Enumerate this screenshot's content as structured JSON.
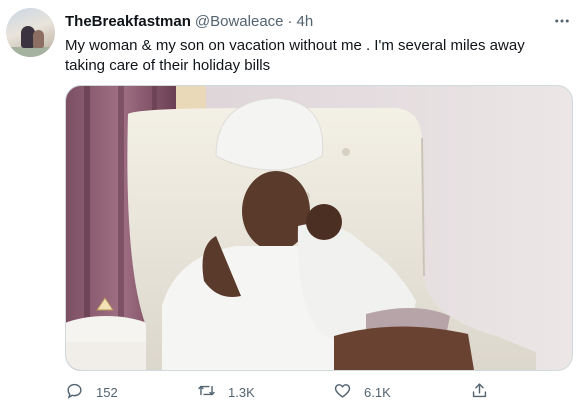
{
  "tweet": {
    "author_name": "TheBreakfastman",
    "handle": "@Bowaleace",
    "separator": "·",
    "time": "4h",
    "text": "My woman & my son on vacation without me . I'm several miles away taking care of their holiday bills",
    "photo_icon": "photo",
    "replies": "152",
    "retweets": "1.3K",
    "likes": "6.1K"
  },
  "icons": {
    "more": "more-horizontal-icon",
    "reply": "reply-icon",
    "retweet": "retweet-icon",
    "like": "heart-icon",
    "share": "share-icon"
  },
  "colors": {
    "text": "#0f1419",
    "secondary": "#536471",
    "border": "#cfd9de"
  }
}
